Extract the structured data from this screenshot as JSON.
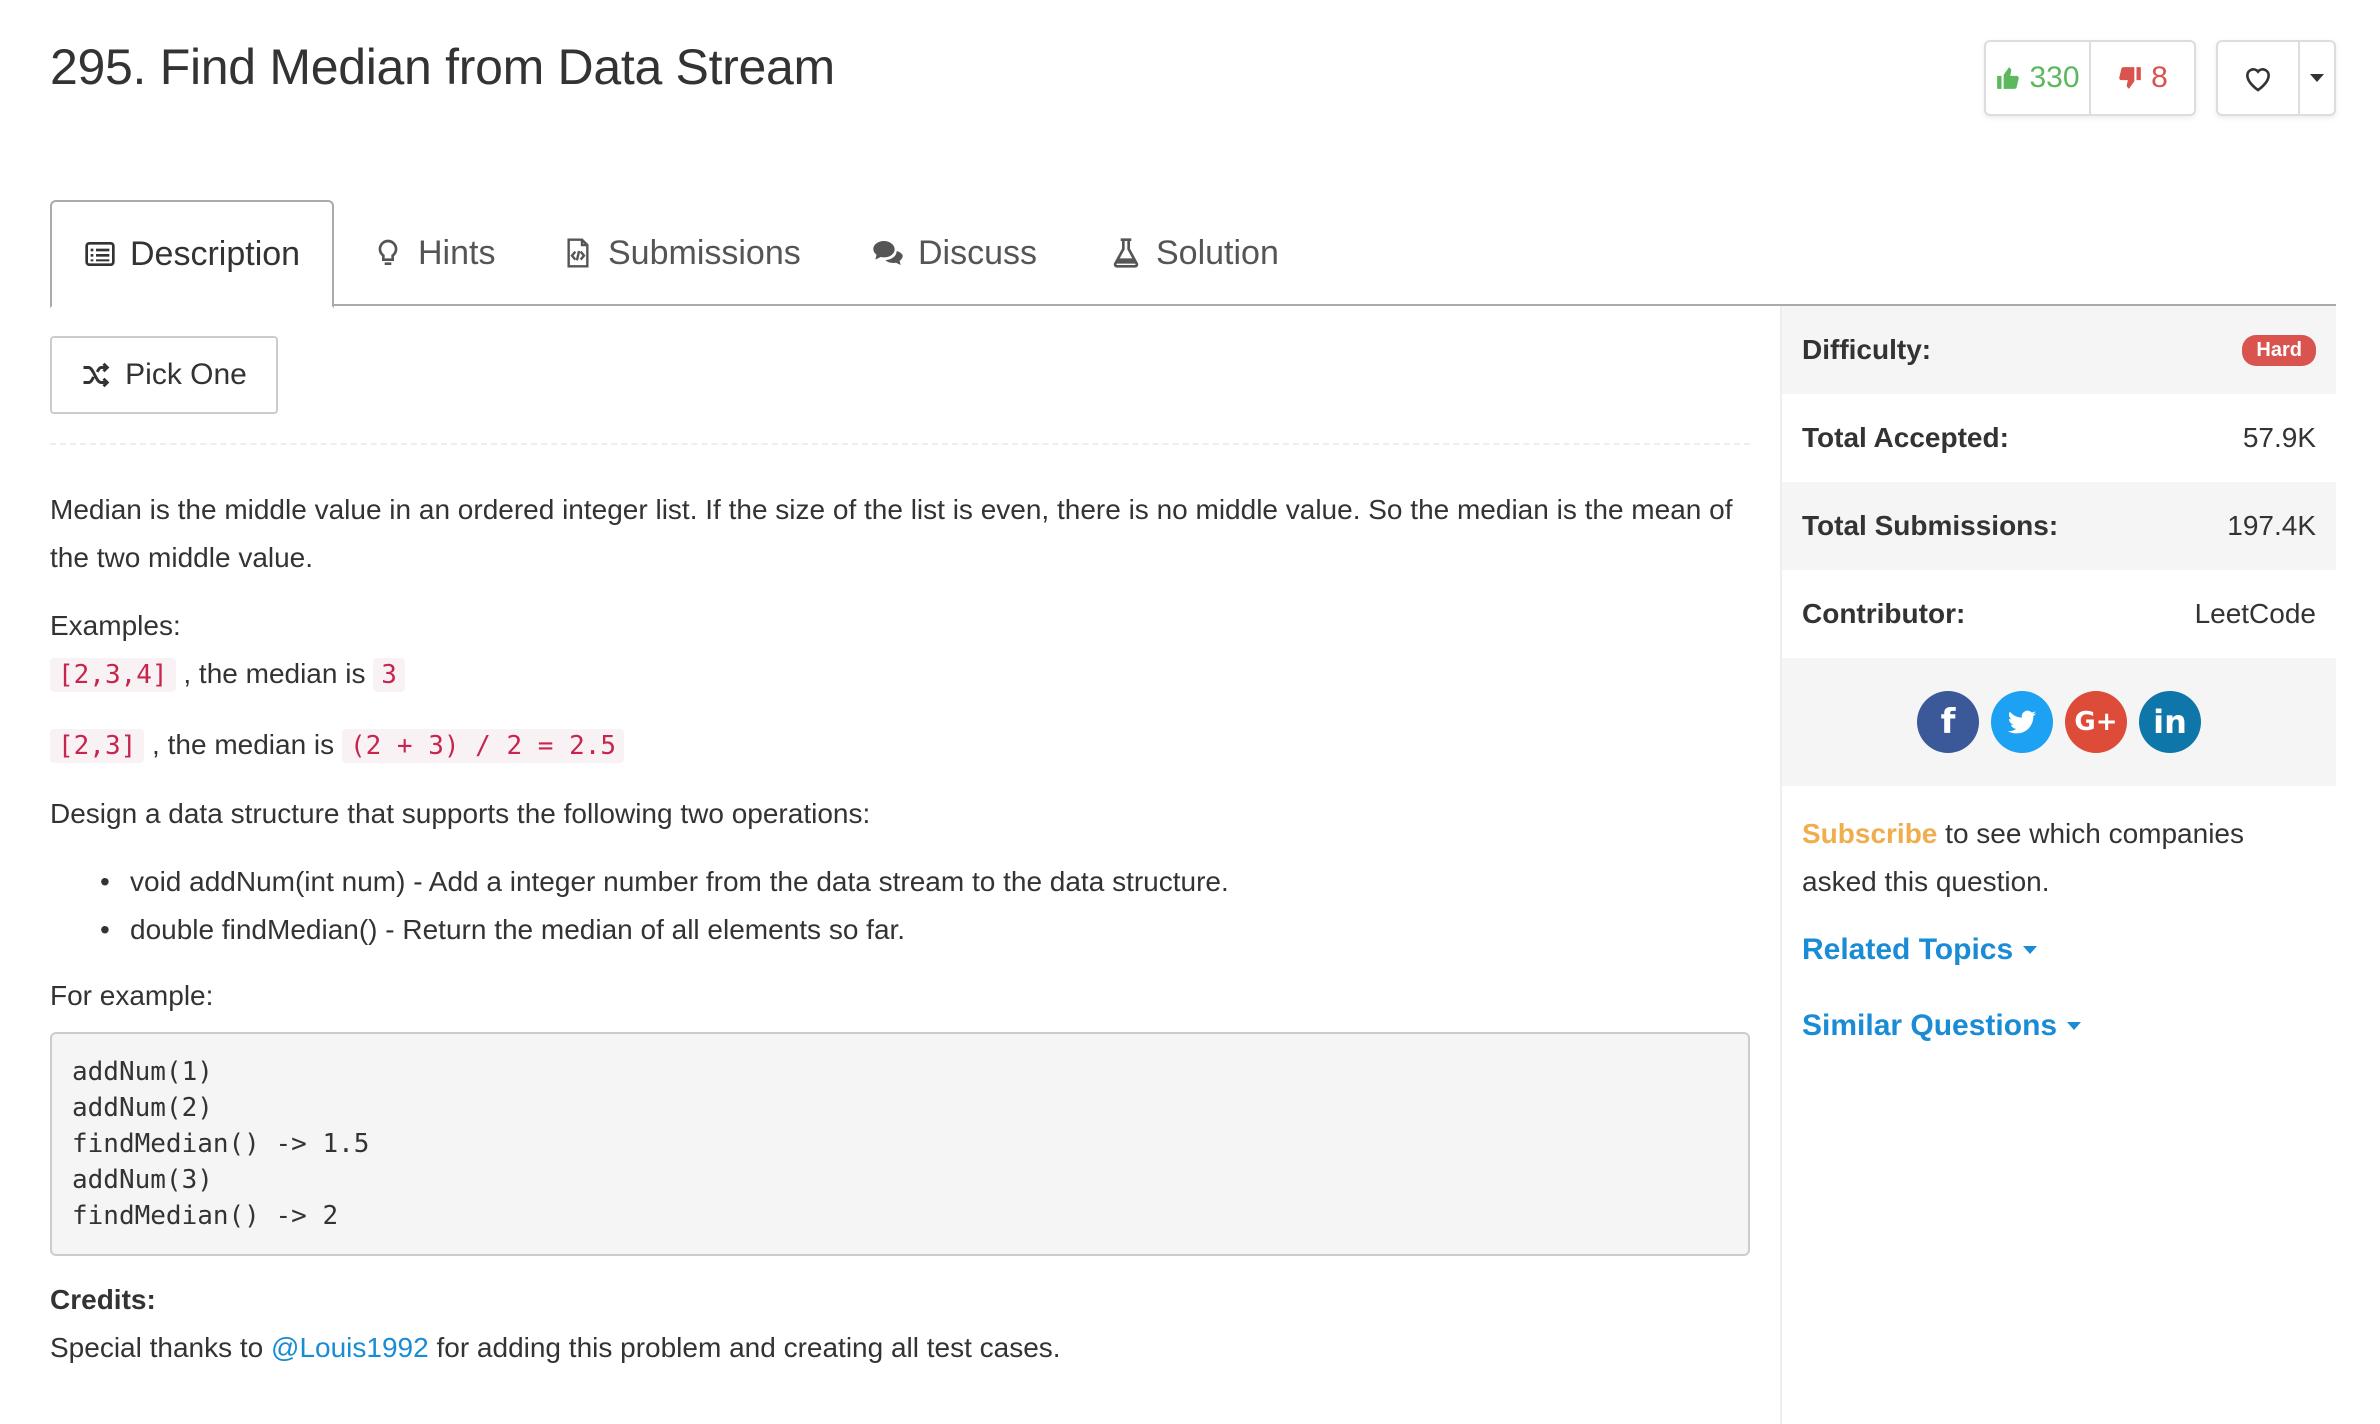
{
  "problem": {
    "title": "295. Find Median from Data Stream",
    "upvotes": "330",
    "downvotes": "8"
  },
  "tabs": [
    {
      "label": "Description",
      "icon": "list-alt-icon",
      "active": true
    },
    {
      "label": "Hints",
      "icon": "lightbulb-icon",
      "active": false
    },
    {
      "label": "Submissions",
      "icon": "code-file-icon",
      "active": false
    },
    {
      "label": "Discuss",
      "icon": "comments-icon",
      "active": false
    },
    {
      "label": "Solution",
      "icon": "flask-icon",
      "active": false
    }
  ],
  "pick_one": {
    "label": "Pick One",
    "icon": "shuffle-icon"
  },
  "description": {
    "intro": "Median is the middle value in an ordered integer list. If the size of the list is even, there is no middle value. So the median is the mean of the two middle value.",
    "examples_label": "Examples:",
    "ex1_code": "[2,3,4]",
    "ex1_text": " , the median is ",
    "ex1_result": "3",
    "ex2_code": "[2,3]",
    "ex2_text": " , the median is ",
    "ex2_result": "(2 + 3) / 2 = 2.5",
    "design_text": "Design a data structure that supports the following two operations:",
    "operations": [
      "void addNum(int num) - Add a integer number from the data stream to the data structure.",
      "double findMedian() - Return the median of all elements so far."
    ],
    "for_example": "For example:",
    "code_block": "addNum(1)\naddNum(2)\nfindMedian() -> 1.5\naddNum(3)\nfindMedian() -> 2",
    "credits_label": "Credits:",
    "credits_prefix": "Special thanks to ",
    "credits_user": "@Louis1992",
    "credits_suffix": " for adding this problem and creating all test cases."
  },
  "sidebar": {
    "difficulty_label": "Difficulty:",
    "difficulty_value": "Hard",
    "accepted_label": "Total Accepted:",
    "accepted_value": "57.9K",
    "submissions_label": "Total Submissions:",
    "submissions_value": "197.4K",
    "contributor_label": "Contributor:",
    "contributor_value": "LeetCode",
    "subscribe_link": "Subscribe",
    "subscribe_text": " to see which companies asked this question.",
    "related_topics": "Related Topics",
    "similar_questions": "Similar Questions"
  },
  "colors": {
    "upvote": "#5cb85c",
    "downvote": "#d9534f",
    "link": "#1a8bd5",
    "subscribe": "#f0ad4e",
    "hard_badge": "#d9534f"
  }
}
